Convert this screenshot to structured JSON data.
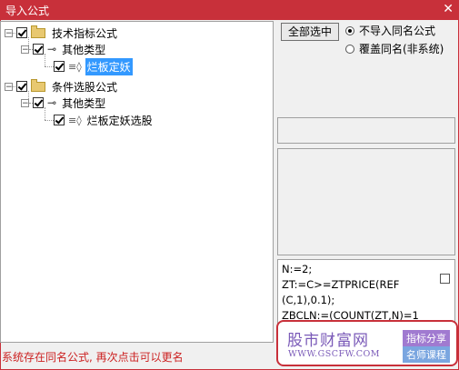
{
  "window": {
    "title": "导入公式",
    "close_glyph": "✕"
  },
  "tree": {
    "nodes": [
      {
        "label": "技术指标公式",
        "checked": true,
        "expander": "−"
      },
      {
        "label": "其他类型",
        "checked": true,
        "expander": "−"
      },
      {
        "label": "烂板定妖",
        "checked": true,
        "selected": true
      },
      {
        "label": "条件选股公式",
        "checked": true,
        "expander": "−"
      },
      {
        "label": "其他类型",
        "checked": true,
        "expander": "−"
      },
      {
        "label": "烂板定妖选股",
        "checked": true
      }
    ]
  },
  "right": {
    "select_all_button": "全部选中",
    "radio_skip": "不导入同名公式",
    "radio_overwrite": "覆盖同名(非系统)",
    "code_lines": [
      "N:=2;",
      "ZT:=C>=ZTPRICE(REF",
      "(C,1),0.1);",
      "ZBCLN:=(COUNT(ZT,N)=1"
    ]
  },
  "status_text": "系统存在同名公式, 再次点击可以更名",
  "watermark": {
    "brand": "股市财富网",
    "url": "WWW.GSCFW.COM",
    "tag1": "指标分享",
    "tag2": "名师课程"
  },
  "colors": {
    "titlebar": "#c8303a",
    "selection": "#3399ff",
    "status": "#cc2222"
  }
}
